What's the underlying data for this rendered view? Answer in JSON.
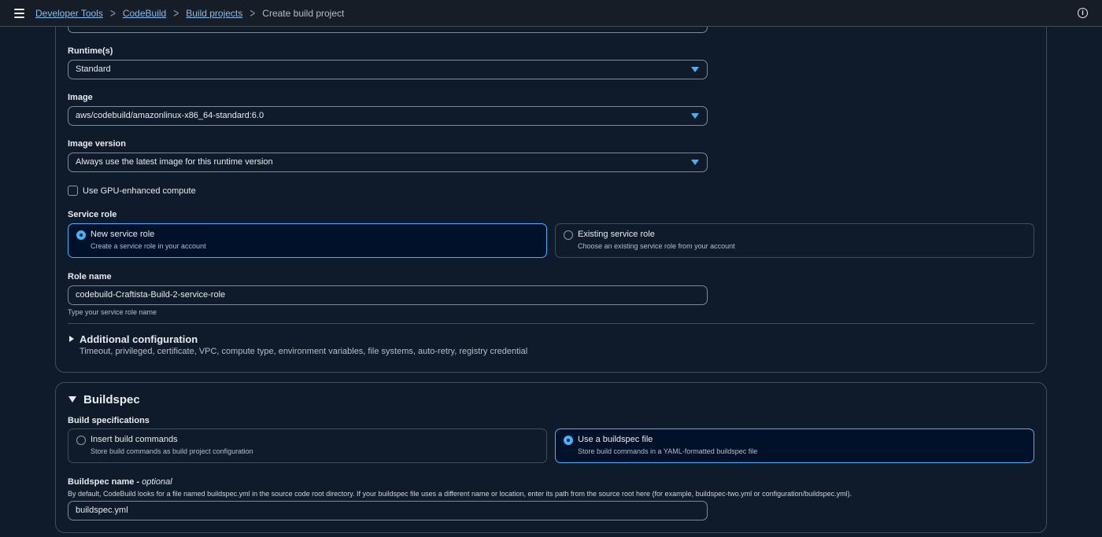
{
  "breadcrumbs": {
    "items": [
      "Developer Tools",
      "CodeBuild",
      "Build projects"
    ],
    "current": "Create build project"
  },
  "environment": {
    "runtime": {
      "label": "Runtime(s)",
      "value": "Standard"
    },
    "image": {
      "label": "Image",
      "value": "aws/codebuild/amazonlinux-x86_64-standard:6.0"
    },
    "image_version": {
      "label": "Image version",
      "value": "Always use the latest image for this runtime version"
    },
    "gpu_checkbox": {
      "label": "Use GPU-enhanced compute",
      "checked": false
    },
    "service_role": {
      "label": "Service role",
      "options": [
        {
          "title": "New service role",
          "description": "Create a service role in your account",
          "selected": true
        },
        {
          "title": "Existing service role",
          "description": "Choose an existing service role from your account",
          "selected": false
        }
      ]
    },
    "role_name": {
      "label": "Role name",
      "value": "codebuild-Craftista-Build-2-service-role",
      "hint": "Type your service role name"
    },
    "additional_config": {
      "title": "Additional configuration",
      "description": "Timeout, privileged, certificate, VPC, compute type, environment variables, file systems, auto-retry, registry credential"
    }
  },
  "buildspec": {
    "title": "Buildspec",
    "specs_label": "Build specifications",
    "options": [
      {
        "title": "Insert build commands",
        "description": "Store build commands as build project configuration",
        "selected": false
      },
      {
        "title": "Use a buildspec file",
        "description": "Store build commands in a YAML-formatted buildspec file",
        "selected": true
      }
    ],
    "name_label": "Buildspec name",
    "name_optional": "optional",
    "name_description": "By default, CodeBuild looks for a file named buildspec.yml in the source code root directory. If your buildspec file uses a different name or location, enter its path from the source root here (for example, buildspec-two.yml or configuration/buildspec.yml).",
    "name_value": "buildspec.yml"
  },
  "colors": {
    "accent": "#42b4ff",
    "link": "#89bdee",
    "background": "#0f1b2a",
    "border": "#414d5c"
  }
}
